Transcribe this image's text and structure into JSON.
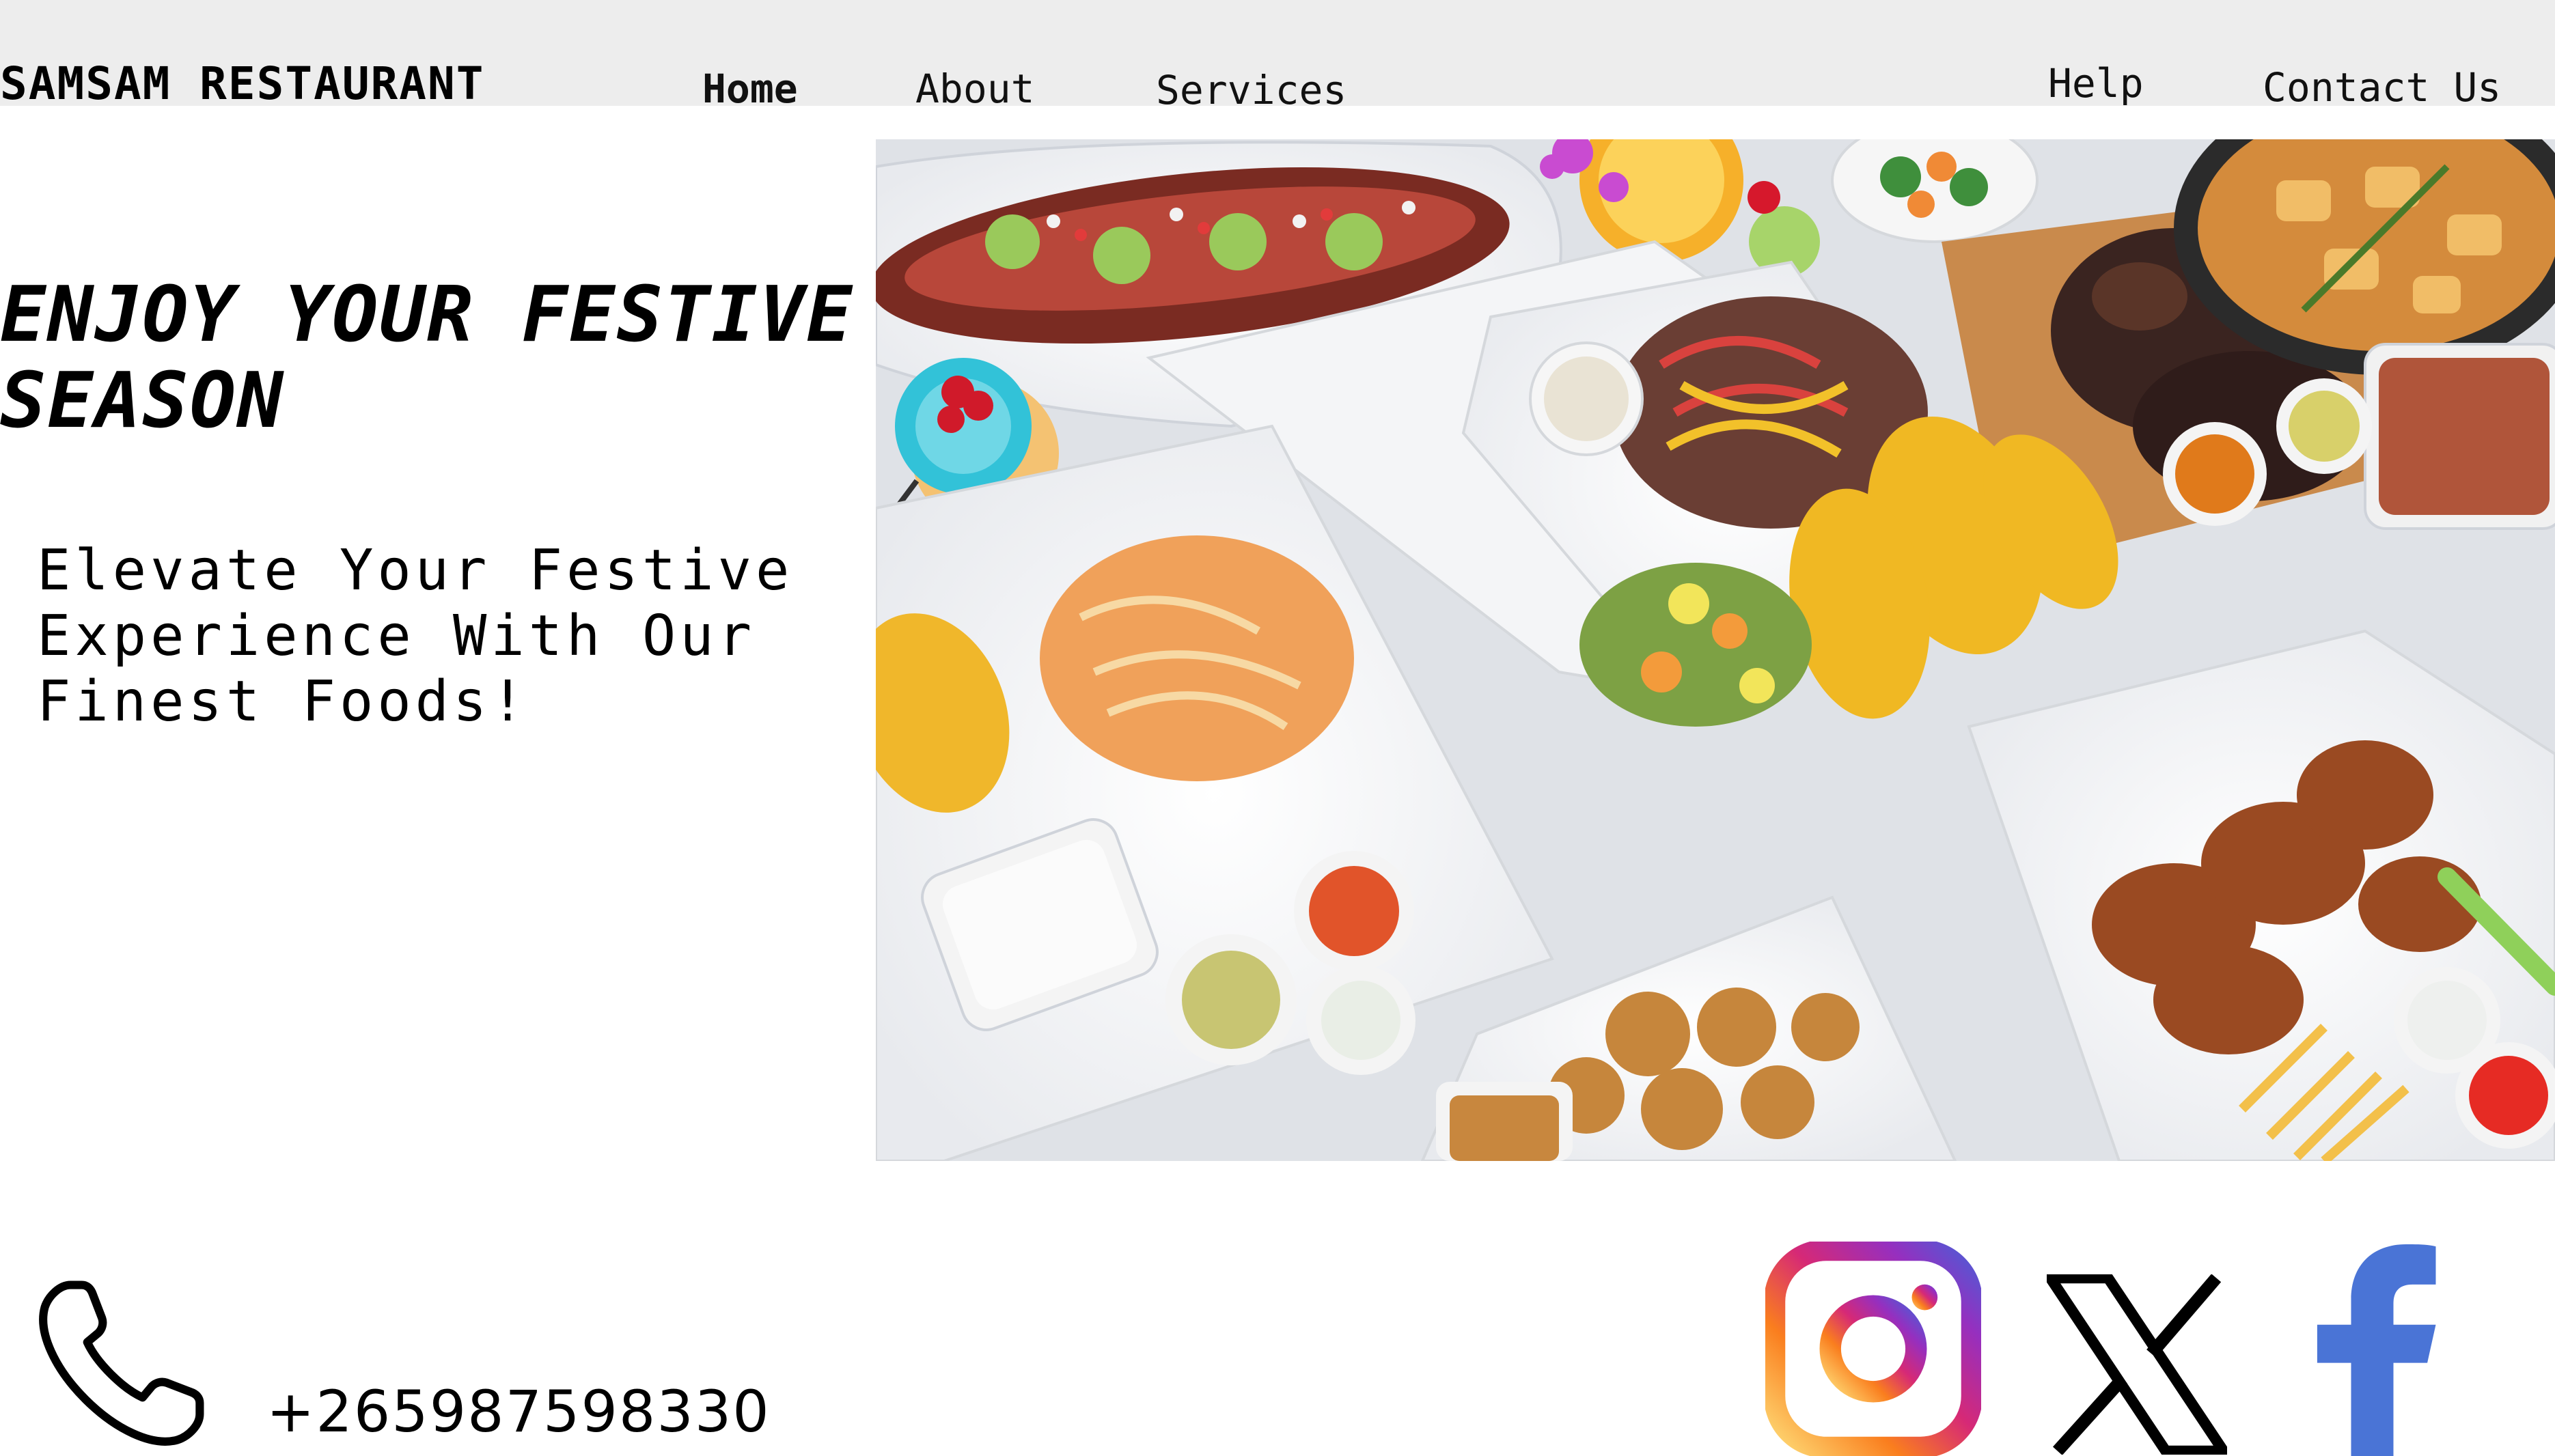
{
  "header": {
    "brand": "SAMSAM RESTAURANT",
    "nav": {
      "home": "Home",
      "about": "About",
      "services": "Services",
      "help": "Help",
      "contact": "Contact Us"
    }
  },
  "hero": {
    "title": "ENJOY YOUR FESTIVE SEASON",
    "subtitle": "Elevate Your Festive Experience With Our Finest Foods!",
    "image_icon": "food-spread-photo"
  },
  "footer": {
    "phone_icon": "phone-icon",
    "phone_number": "+265987598330",
    "social": [
      "instagram-icon",
      "x-icon",
      "facebook-icon"
    ]
  },
  "colors": {
    "header_bg": "#ededed",
    "page_bg": "#ffffff",
    "text": "#000000",
    "facebook_blue": "#4a74d6",
    "instagram_gradient": [
      "#feda75",
      "#fa7e1e",
      "#d62976",
      "#962fbf",
      "#4f5bd5"
    ]
  }
}
